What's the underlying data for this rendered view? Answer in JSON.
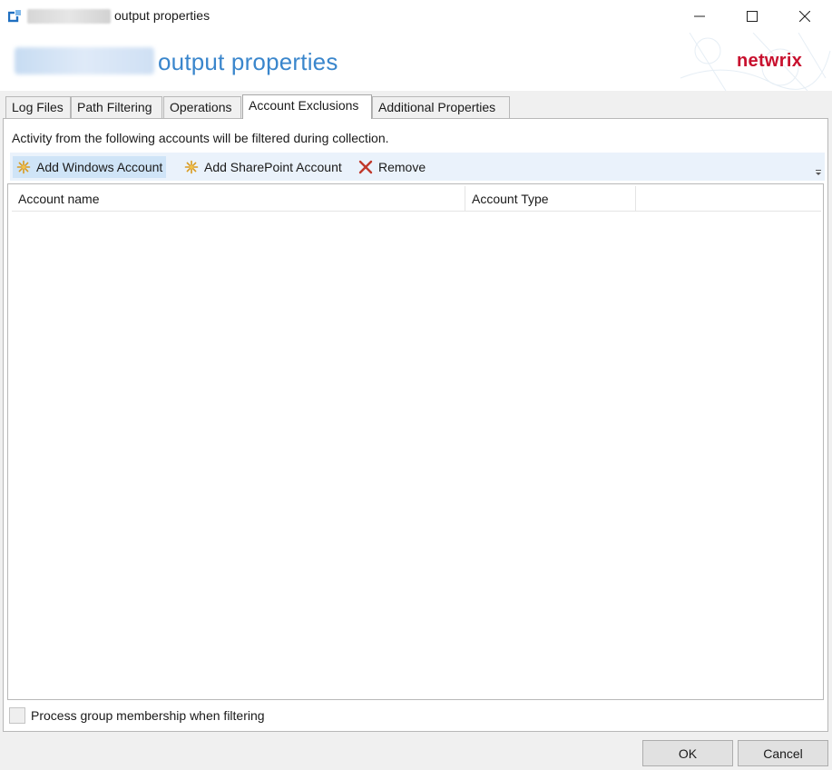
{
  "window": {
    "title": "output properties",
    "icons": {
      "app": "app-logo-icon",
      "minimize": "minimize-icon",
      "maximize": "maximize-icon",
      "close": "close-icon"
    }
  },
  "header": {
    "title": "output properties",
    "brand": "netwrix",
    "brand_color": "#c8102e",
    "title_color": "#3a86cc"
  },
  "tabs": [
    {
      "label": "Log Files"
    },
    {
      "label": "Path Filtering"
    },
    {
      "label": "Operations"
    },
    {
      "label": "Account Exclusions",
      "active": true
    },
    {
      "label": "Additional Properties"
    }
  ],
  "panel": {
    "instruction": "Activity from the following accounts will be filtered during collection.",
    "toolbar": {
      "add_windows": "Add Windows Account",
      "add_sharepoint": "Add SharePoint Account",
      "remove": "Remove",
      "icons": {
        "add": "sparkle-add-icon",
        "remove": "red-x-remove-icon",
        "overflow": "overflow-chevron-icon"
      }
    },
    "grid": {
      "columns": [
        "Account name",
        "Account Type"
      ],
      "rows": []
    },
    "process_group_label": "Process group membership when filtering",
    "process_group_checked": false
  },
  "buttons": {
    "ok": "OK",
    "cancel": "Cancel"
  }
}
